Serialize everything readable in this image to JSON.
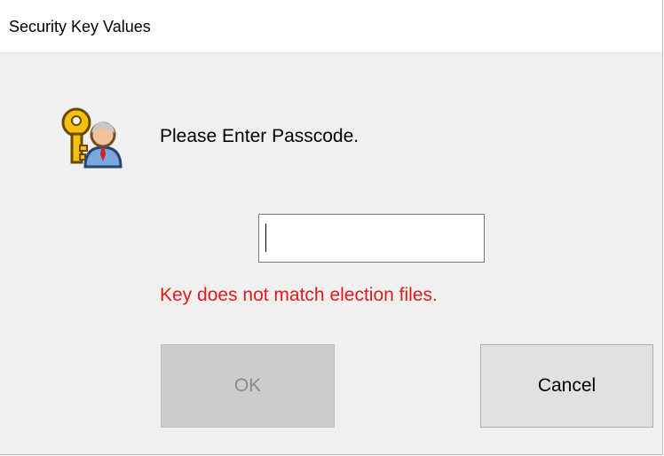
{
  "window": {
    "title": "Security Key Values"
  },
  "dialog": {
    "icon": "key-user-icon",
    "prompt": "Please Enter Passcode.",
    "passcode": {
      "value": "",
      "placeholder": ""
    },
    "error_message": "Key does not match election files.",
    "buttons": {
      "ok_label": "OK",
      "ok_enabled": false,
      "cancel_label": "Cancel"
    }
  },
  "colors": {
    "error": "#e01a1a",
    "disabled_button": "#cccccc",
    "button": "#e1e1e1",
    "dialog_background": "#f0f0f0"
  }
}
